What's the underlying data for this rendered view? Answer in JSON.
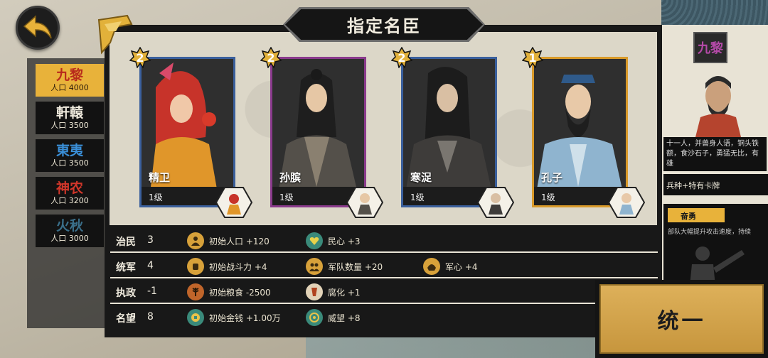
{
  "title": "指定名臣",
  "nations": [
    {
      "name": "九黎",
      "pop_label": "人口 4000",
      "color": "#b82a1c",
      "active": true
    },
    {
      "name": "軒轅",
      "pop_label": "人口 3500",
      "color": "#f1ecdf",
      "active": false
    },
    {
      "name": "東夷",
      "pop_label": "人口 3500",
      "color": "#3a8fd8",
      "active": false
    },
    {
      "name": "神农",
      "pop_label": "人口 3200",
      "color": "#d0362a",
      "active": false
    },
    {
      "name": "火秋",
      "pop_label": "人口 3000",
      "color": "#3a6f8a",
      "active": false
    }
  ],
  "cards": [
    {
      "name": "精卫",
      "level": "1级",
      "rank": "2",
      "border": "#3a5f9c"
    },
    {
      "name": "孙膑",
      "level": "1级",
      "rank": "2",
      "border": "#8a3a8c"
    },
    {
      "name": "寒浞",
      "level": "1级",
      "rank": "2",
      "border": "#3a5f9c"
    },
    {
      "name": "孔子",
      "level": "1级",
      "rank": "1",
      "border": "#d99a2a"
    }
  ],
  "stats": [
    {
      "label": "治民",
      "value": "3",
      "effects": [
        {
          "icon": "population-icon",
          "text": "初始人口  +120",
          "color": "#d7a13a"
        },
        {
          "icon": "heart-icon",
          "text": "民心  +3",
          "color": "#3a8a7a"
        }
      ]
    },
    {
      "label": "统军",
      "value": "4",
      "effects": [
        {
          "icon": "fist-icon",
          "text": "初始战斗力  +4",
          "color": "#d7a13a"
        },
        {
          "icon": "troops-icon",
          "text": "军队数量  +20",
          "color": "#d7a13a"
        },
        {
          "icon": "morale-icon",
          "text": "军心  +4",
          "color": "#d7a13a"
        }
      ]
    },
    {
      "label": "执政",
      "value": "-1",
      "effects": [
        {
          "icon": "grain-icon",
          "text": "初始粮食  -2500",
          "color": "#c0652a"
        },
        {
          "icon": "corruption-icon",
          "text": "腐化  +1",
          "color": "#e2d3b8"
        }
      ]
    },
    {
      "label": "名望",
      "value": "8",
      "effects": [
        {
          "icon": "coin-icon",
          "text": "初始金钱  +1.00万",
          "color": "#3a8a7a"
        },
        {
          "icon": "prestige-icon",
          "text": "威望  +8",
          "color": "#3a8a7a"
        }
      ]
    }
  ],
  "right_panel": {
    "nation": "九黎",
    "desc": "十一人，并兽身人语，铜头铁额，食沙石子，勇猛无比，有雄",
    "traits": "兵种+特有卡牌",
    "skill_title": "奋勇",
    "skill_text": "部队大幅提升攻击速度，持续"
  },
  "unify_label": "统一"
}
